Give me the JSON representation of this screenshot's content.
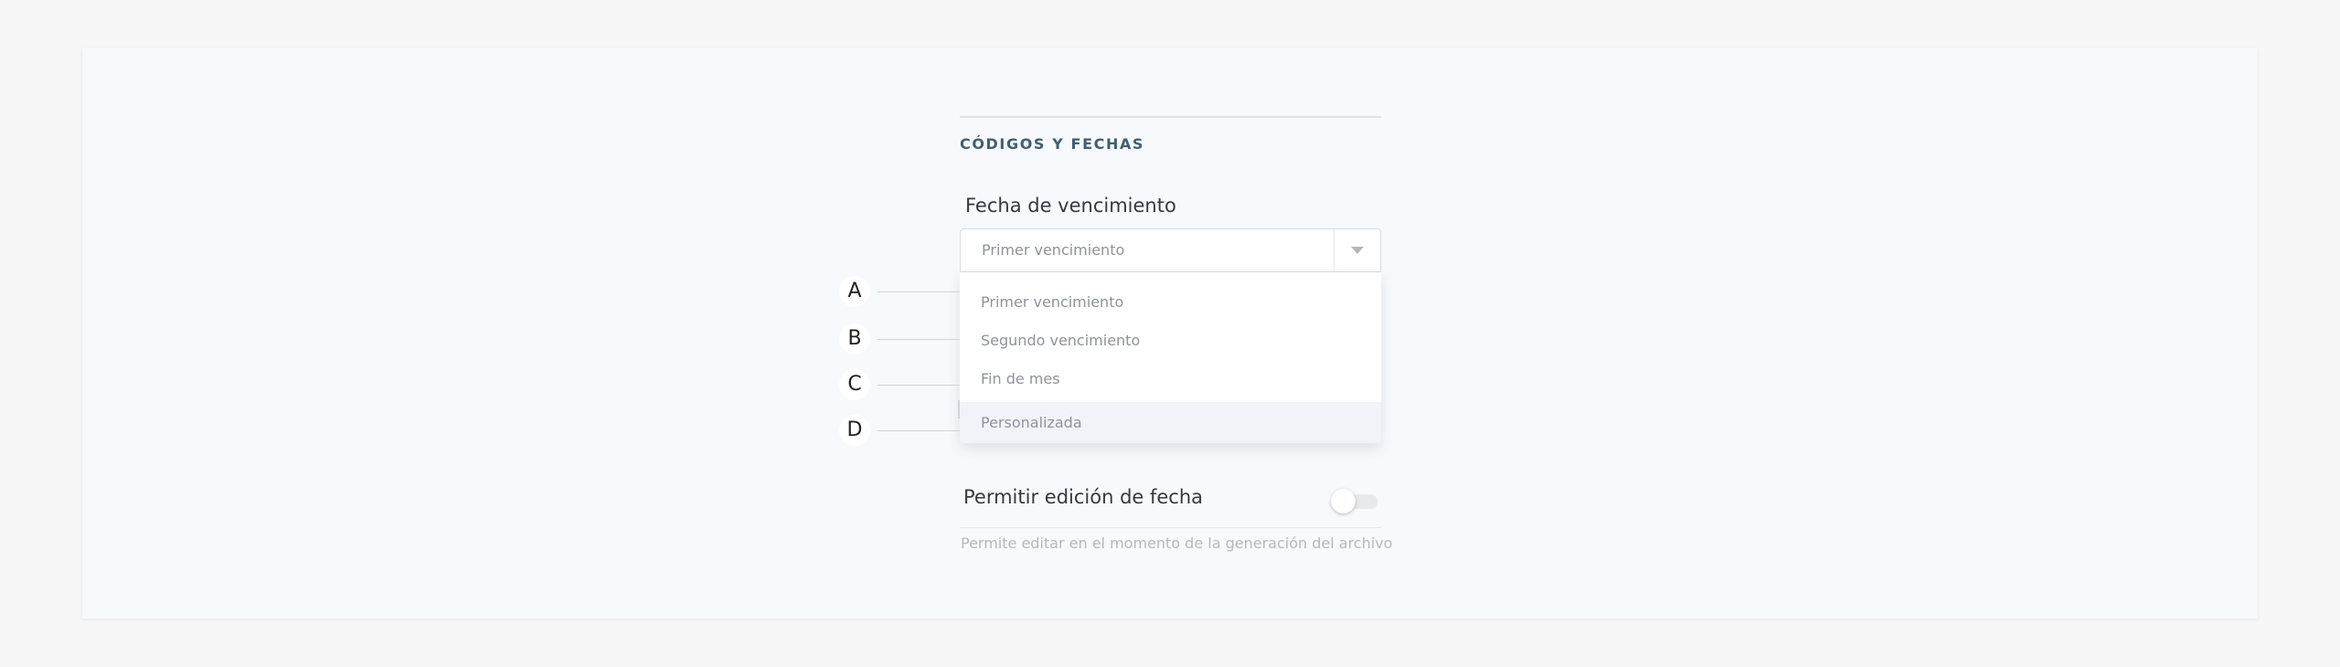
{
  "section": {
    "title": "CÓDIGOS Y FECHAS"
  },
  "due_date": {
    "label": "Fecha de vencimiento",
    "selected": "Primer vencimiento",
    "options": [
      "Primer vencimiento",
      "Segundo vencimiento",
      "Fin de mes",
      "Personalizada"
    ],
    "hovered_option": "Personalizada"
  },
  "markers": [
    "A",
    "B",
    "C",
    "D"
  ],
  "edit_toggle": {
    "label": "Permitir edición de fecha",
    "enabled": false,
    "helper": "Permite editar en el momento de la generación del archivo"
  },
  "colors": {
    "section_title": "#3f5e76",
    "hover_background": "#f1f3f9",
    "text_muted": "#8e939b"
  },
  "icons": {
    "select_toggle": "caret-down-icon"
  }
}
